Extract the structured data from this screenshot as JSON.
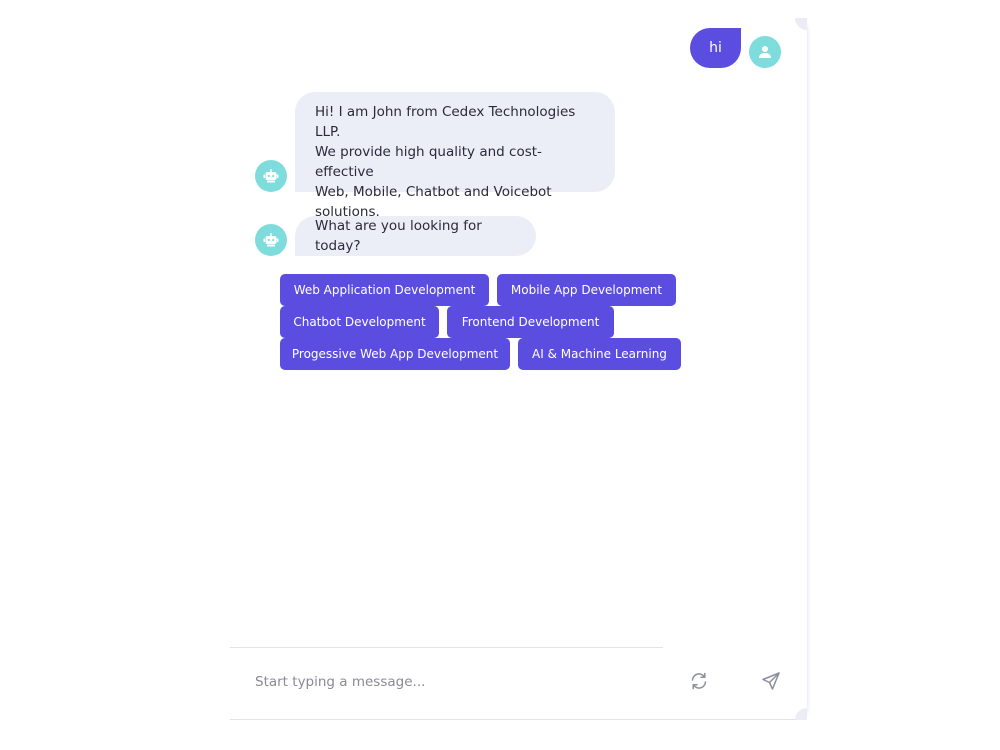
{
  "user_message": {
    "text": "hi"
  },
  "bot_messages": [
    {
      "lines": [
        "Hi! I am John from Cedex Technologies LLP.",
        "We provide high quality and cost-effective",
        "Web, Mobile, Chatbot and Voicebot",
        "solutions."
      ]
    },
    {
      "lines": [
        "What are you looking for today?"
      ]
    }
  ],
  "quick_replies": [
    "Web Application Development",
    "Mobile App Development",
    "Chatbot Development",
    "Frontend Development",
    "Progessive Web App Development",
    "AI & Machine Learning"
  ],
  "composer": {
    "placeholder": "Start typing a message..."
  },
  "colors": {
    "accent": "#5b4de0",
    "avatar_bg": "#7fdcdc",
    "bot_bubble_bg": "#eceef7"
  },
  "icons": {
    "user_avatar": "user-icon",
    "bot_avatar": "robot-icon",
    "refresh": "refresh-icon",
    "send": "send-icon"
  }
}
